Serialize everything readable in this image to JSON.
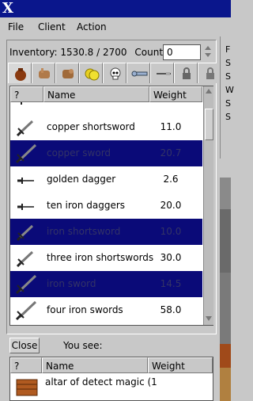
{
  "window": {
    "logo": "X"
  },
  "menu": [
    "File",
    "Client",
    "Action"
  ],
  "inventory": {
    "label": "Inventory:",
    "weight": "1530.8",
    "capacity": "/ 2700",
    "count_label": "Count:",
    "count_value": "0"
  },
  "tabs": [
    {
      "icon": "bag-icon",
      "active": true
    },
    {
      "icon": "hands-icon",
      "active": false
    },
    {
      "icon": "hands-alt-icon",
      "active": false
    },
    {
      "icon": "coins-icon",
      "active": false
    },
    {
      "icon": "skull-icon",
      "active": false
    },
    {
      "icon": "key-icon",
      "active": false
    },
    {
      "icon": "wand-icon",
      "active": false
    },
    {
      "icon": "lock-icon",
      "active": false
    },
    {
      "icon": "lock-alt-icon",
      "active": false
    }
  ],
  "table": {
    "columns": [
      "?",
      "Name",
      "Weight"
    ],
    "rows": [
      {
        "name": "",
        "weight": "",
        "selected": false,
        "icon": "shortsword-icon"
      },
      {
        "name": "copper shortsword",
        "weight": "11.0",
        "selected": false,
        "icon": "shortsword-icon"
      },
      {
        "name": "copper sword",
        "weight": "20.7",
        "selected": true,
        "icon": "sword-icon"
      },
      {
        "name": "golden dagger",
        "weight": "2.6",
        "selected": false,
        "icon": "dagger-icon"
      },
      {
        "name": "ten iron daggers",
        "weight": "20.0",
        "selected": false,
        "icon": "dagger-icon"
      },
      {
        "name": "iron shortsword",
        "weight": "10.0",
        "selected": true,
        "icon": "shortsword-icon"
      },
      {
        "name": "three iron shortswords",
        "weight": "30.0",
        "selected": false,
        "icon": "shortsword-icon"
      },
      {
        "name": "iron sword",
        "weight": "14.5",
        "selected": true,
        "icon": "sword-icon"
      },
      {
        "name": "four iron swords",
        "weight": "58.0",
        "selected": false,
        "icon": "sword-icon"
      }
    ]
  },
  "bottom": {
    "close_label": "Close",
    "you_see": "You see:",
    "columns": [
      "?",
      "Name",
      "Weight"
    ],
    "rows": [
      {
        "name": "altar of detect magic (1",
        "icon": "altar-icon"
      }
    ]
  },
  "side_labels": [
    "F",
    "S",
    "S",
    "W",
    "S",
    "S"
  ],
  "colors": {
    "titlebar": "#0a168c",
    "selection": "#0a0a78",
    "panel": "#c8c8c8"
  }
}
